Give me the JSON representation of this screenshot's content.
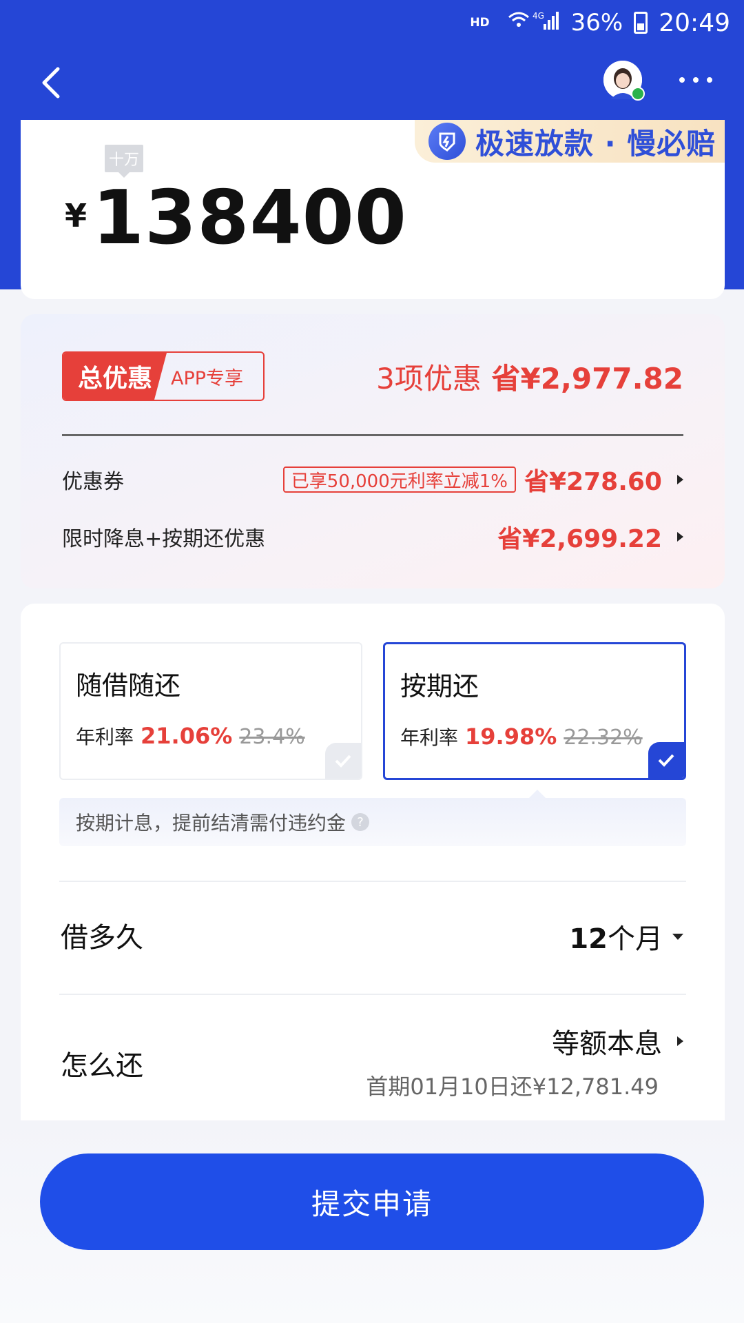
{
  "status_bar": {
    "hd": "HD",
    "network": "4G",
    "battery": "36%",
    "time": "20:49"
  },
  "nav": {
    "back_icon": "chevron-left-icon",
    "more_icon": "more-dots-icon"
  },
  "amount_card": {
    "promo_text": "极速放款 · 慢必赔",
    "unit_tag": "十万",
    "currency": "¥",
    "amount": "138400"
  },
  "discount": {
    "badge_main": "总优惠",
    "badge_sub": "APP专享",
    "count_text": "3项优惠",
    "save_total": "省¥2,977.82",
    "rows": [
      {
        "label": "优惠券",
        "tag": "已享50,000元利率立减1%",
        "amount": "省¥278.60"
      },
      {
        "label": "限时降息+按期还优惠",
        "tag": "",
        "amount": "省¥2,699.22"
      }
    ]
  },
  "repay": {
    "options": [
      {
        "title": "随借随还",
        "rate_label": "年利率",
        "rate_now": "21.06%",
        "rate_old": "23.4%",
        "selected": false
      },
      {
        "title": "按期还",
        "rate_label": "年利率",
        "rate_now": "19.98%",
        "rate_old": "22.32%",
        "selected": true
      }
    ],
    "hint": "按期计息，提前结清需付违约金",
    "term_label": "借多久",
    "term_num": "12",
    "term_unit": "个月",
    "method_label": "怎么还",
    "method_value": "等额本息",
    "first_payment": "首期01月10日还¥12,781.49"
  },
  "submit_label": "提交申请",
  "colors": {
    "brand_blue": "#2546d6",
    "accent_red": "#e6403a"
  }
}
